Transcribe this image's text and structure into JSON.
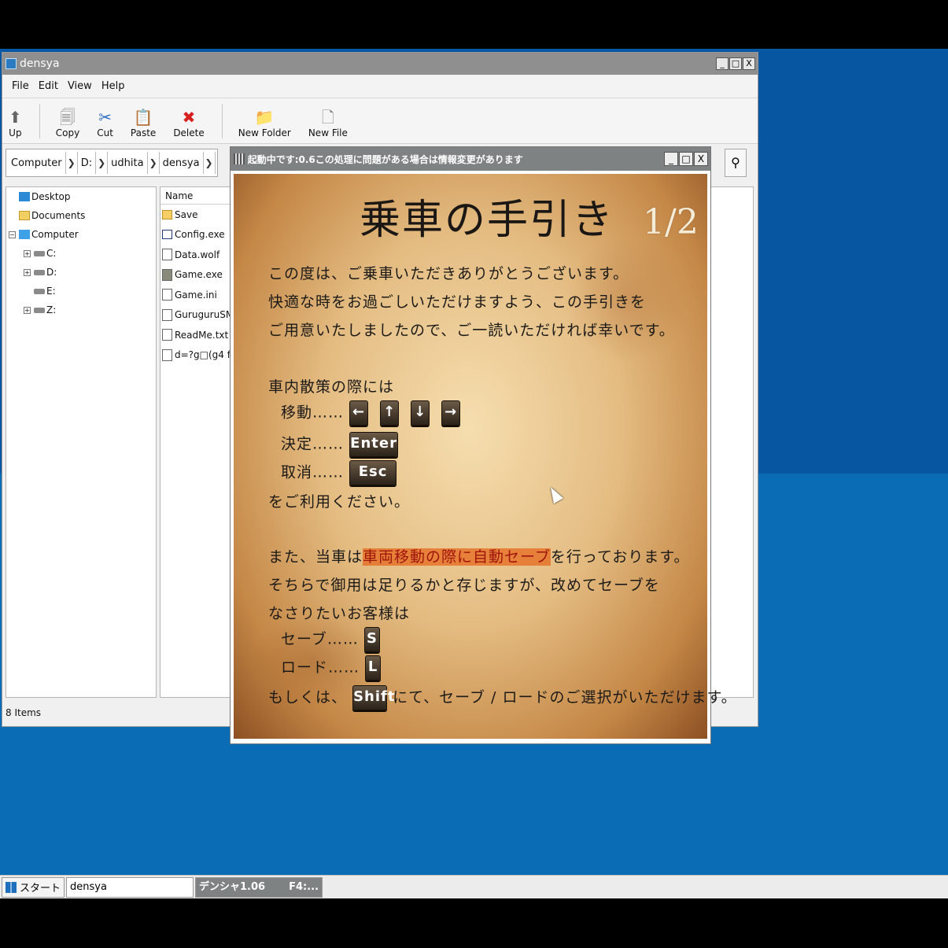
{
  "explorer": {
    "title": "densya",
    "menu": [
      "File",
      "Edit",
      "View",
      "Help"
    ],
    "toolbar": {
      "up": "Up",
      "copy": "Copy",
      "cut": "Cut",
      "paste": "Paste",
      "delete": "Delete",
      "new_folder": "New Folder",
      "new_file": "New File"
    },
    "breadcrumb": [
      "Computer",
      "D:",
      "udhita",
      "densya"
    ],
    "tree": {
      "desktop": "Desktop",
      "documents": "Documents",
      "computer": "Computer",
      "c": "C:",
      "d": "D:",
      "e": "E:",
      "z": "Z:"
    },
    "files": {
      "column_name": "Name",
      "items": [
        "Save",
        "Config.exe",
        "Data.wolf",
        "Game.exe",
        "Game.ini",
        "GuruguruSMF4.d",
        "ReadMe.txt",
        "d=?g□(g4 f□□"
      ]
    },
    "status": "8 Items"
  },
  "game": {
    "title": "起動中です:0.6この処理に問題がある場合は情報変更があります",
    "page_title": "乗車の手引き",
    "page_number": "1/2",
    "intro": [
      "この度は、ご乗車いただきありがとうございます。",
      "快適な時をお過ごしいただけますよう、この手引きを",
      "ご用意いたしましたので、ご一読いただければ幸いです。"
    ],
    "walk_heading": "車内散策の際には",
    "move_label": "移動……",
    "decide_label": "決定……",
    "cancel_label": "取消……",
    "keys": {
      "left": "←",
      "up": "↑",
      "down": "↓",
      "right": "→",
      "enter": "Enter",
      "esc": "Esc",
      "s": "S",
      "l": "L",
      "shift": "Shift"
    },
    "use_text": "をご利用ください。",
    "save_line_a": "また、当車は",
    "save_line_hl": "車両移動の際に自動セーブ",
    "save_line_b": "を行っております。",
    "save_line2": "そちらで御用は足りるかと存じますが、改めてセーブを",
    "save_line3": "なさりたいお客様は",
    "save_label": "セーブ……",
    "load_label": "ロード……",
    "shift_prefix": "もしくは、",
    "shift_suffix": "にて、セーブ / ロードのご選択がいただけます。"
  },
  "taskbar": {
    "start": "スタート",
    "task1": "densya",
    "task2": "デンシャ1.06",
    "task2_hint": "F4:..."
  }
}
